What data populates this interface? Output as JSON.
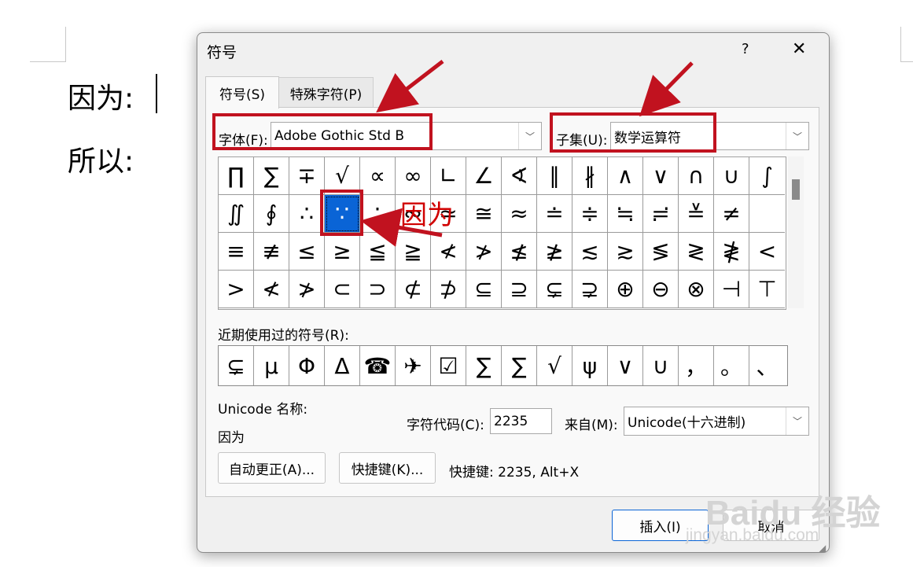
{
  "document": {
    "line1": "因为:",
    "line2": "所以:"
  },
  "dialog": {
    "title": "符号",
    "help": "?",
    "close": "✕",
    "tabs": [
      {
        "label": "符号(S)",
        "active": true
      },
      {
        "label": "特殊字符(P)",
        "active": false
      }
    ],
    "font_label": "字体(F):",
    "font_value": "Adobe Gothic Std B",
    "subset_label": "子集(U):",
    "subset_value": "数学运算符",
    "symbol_rows": [
      [
        "∏",
        "∑",
        "∓",
        "√",
        "∝",
        "∞",
        "∟",
        "∠",
        "∢",
        "∥",
        "∦",
        "∧",
        "∨",
        "∩",
        "∪",
        "∫"
      ],
      [
        "∬",
        "∮",
        "∴",
        "∵",
        "∶",
        "∾",
        "≃",
        "≅",
        "≈",
        "≐",
        "≑",
        "≒",
        "≓",
        "≚",
        "≠",
        ""
      ],
      [
        "≡",
        "≢",
        "≤",
        "≥",
        "≦",
        "≧",
        "≮",
        "≯",
        "≰",
        "≱",
        "≲",
        "≳",
        "≶",
        "≷",
        "≹",
        "<"
      ],
      [
        ">",
        "≮",
        "≯",
        "⊂",
        "⊃",
        "⊄",
        "⊅",
        "⊆",
        "⊇",
        "⊊",
        "⊋",
        "⊕",
        "⊖",
        "⊗",
        "⊣",
        "⊤"
      ]
    ],
    "selected_symbol": "∵",
    "recent_label": "近期使用过的符号(R):",
    "recent_symbols": [
      "⊊",
      "μ",
      "Φ",
      "Δ",
      "☎",
      "✈",
      "☑",
      "∑",
      "∑",
      "√",
      "ψ",
      "∨",
      "∪",
      "，",
      "。",
      "、"
    ],
    "unicode_name_label": "Unicode 名称:",
    "unicode_name_value": "因为",
    "char_code_label": "字符代码(C):",
    "char_code_value": "2235",
    "from_label": "来自(M):",
    "from_value": "Unicode(十六进制)",
    "autocorrect_button": "自动更正(A)...",
    "shortcut_button": "快捷键(K)...",
    "shortcut_text": "快捷键: 2235, Alt+X",
    "insert_button": "插入(I)",
    "cancel_button": "取消"
  },
  "annotations": {
    "because_label": "因为",
    "color": "#c1121f"
  },
  "watermark": {
    "brand": "Baidu 经验",
    "url": "jingyan.baidu.com"
  },
  "colors": {
    "selection": "#0a64d6",
    "annotation_red": "#c1121f",
    "dialog_bg": "#f0f0f0"
  }
}
